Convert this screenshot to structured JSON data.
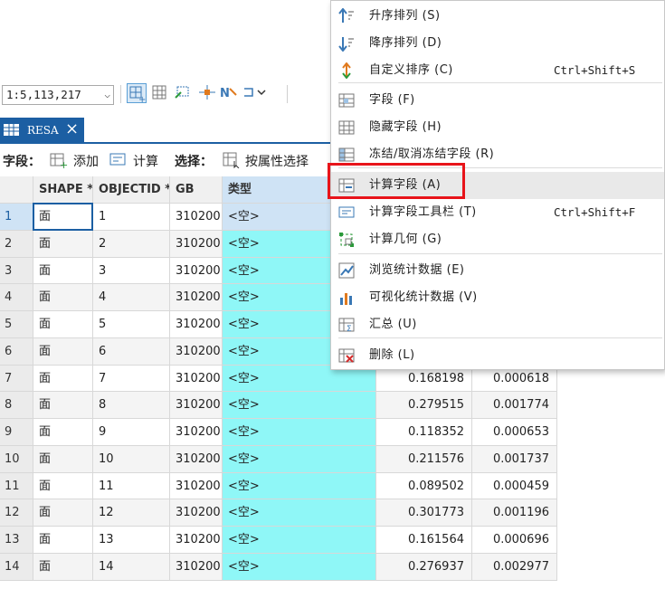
{
  "toolbar": {
    "scale": "1:5,113,217"
  },
  "tab": {
    "label": "RESA"
  },
  "fields_bar": {
    "fields_label": "字段：",
    "add": "添加",
    "calculate": "计算",
    "select_label": "选择：",
    "select_by_attr": "按属性选择"
  },
  "table": {
    "columns": [
      "",
      "SHAPE *",
      "OBJECTID *",
      "GB",
      "类型"
    ],
    "rows": [
      {
        "n": "1",
        "shape": "面",
        "oid": "1",
        "gb": "310200",
        "type": "<空>",
        "v1": "",
        "v2": ""
      },
      {
        "n": "2",
        "shape": "面",
        "oid": "2",
        "gb": "310200",
        "type": "<空>",
        "v1": "",
        "v2": ""
      },
      {
        "n": "3",
        "shape": "面",
        "oid": "3",
        "gb": "310200",
        "type": "<空>",
        "v1": "",
        "v2": ""
      },
      {
        "n": "4",
        "shape": "面",
        "oid": "4",
        "gb": "310200",
        "type": "<空>",
        "v1": "",
        "v2": ""
      },
      {
        "n": "5",
        "shape": "面",
        "oid": "5",
        "gb": "310200",
        "type": "<空>",
        "v1": "",
        "v2": ""
      },
      {
        "n": "6",
        "shape": "面",
        "oid": "6",
        "gb": "310200",
        "type": "<空>",
        "v1": "",
        "v2": ""
      },
      {
        "n": "7",
        "shape": "面",
        "oid": "7",
        "gb": "310200",
        "type": "<空>",
        "v1": "0.168198",
        "v2": "0.000618"
      },
      {
        "n": "8",
        "shape": "面",
        "oid": "8",
        "gb": "310200",
        "type": "<空>",
        "v1": "0.279515",
        "v2": "0.001774"
      },
      {
        "n": "9",
        "shape": "面",
        "oid": "9",
        "gb": "310200",
        "type": "<空>",
        "v1": "0.118352",
        "v2": "0.000653"
      },
      {
        "n": "10",
        "shape": "面",
        "oid": "10",
        "gb": "310200",
        "type": "<空>",
        "v1": "0.211576",
        "v2": "0.001737"
      },
      {
        "n": "11",
        "shape": "面",
        "oid": "11",
        "gb": "310200",
        "type": "<空>",
        "v1": "0.089502",
        "v2": "0.000459"
      },
      {
        "n": "12",
        "shape": "面",
        "oid": "12",
        "gb": "310200",
        "type": "<空>",
        "v1": "0.301773",
        "v2": "0.001196"
      },
      {
        "n": "13",
        "shape": "面",
        "oid": "13",
        "gb": "310200",
        "type": "<空>",
        "v1": "0.161564",
        "v2": "0.000696"
      },
      {
        "n": "14",
        "shape": "面",
        "oid": "14",
        "gb": "310200",
        "type": "<空>",
        "v1": "0.276937",
        "v2": "0.002977"
      }
    ]
  },
  "menu": {
    "items": [
      {
        "label": "升序排列 (S)",
        "shortcut": "",
        "icon": "sort-ascending-icon"
      },
      {
        "label": "降序排列 (D)",
        "shortcut": "",
        "icon": "sort-descending-icon"
      },
      {
        "label": "自定义排序 (C)",
        "shortcut": "Ctrl+Shift+S",
        "icon": "custom-sort-icon"
      },
      {
        "label": "字段 (F)",
        "shortcut": "",
        "icon": "fields-icon"
      },
      {
        "label": "隐藏字段 (H)",
        "shortcut": "",
        "icon": "hide-field-icon"
      },
      {
        "label": "冻结/取消冻结字段 (R)",
        "shortcut": "",
        "icon": "freeze-field-icon"
      },
      {
        "label": "计算字段 (A)",
        "shortcut": "",
        "icon": "calculate-field-icon"
      },
      {
        "label": "计算字段工具栏 (T)",
        "shortcut": "Ctrl+Shift+F",
        "icon": "calculate-toolbar-icon"
      },
      {
        "label": "计算几何 (G)",
        "shortcut": "",
        "icon": "calculate-geometry-icon"
      },
      {
        "label": "浏览统计数据 (E)",
        "shortcut": "",
        "icon": "statistics-icon"
      },
      {
        "label": "可视化统计数据 (V)",
        "shortcut": "",
        "icon": "visualize-statistics-icon"
      },
      {
        "label": "汇总 (U)",
        "shortcut": "",
        "icon": "summarize-icon"
      },
      {
        "label": "删除 (L)",
        "shortcut": "",
        "icon": "delete-field-icon"
      }
    ]
  },
  "colors": {
    "tab": "#1c5fa3",
    "type_column": "#8ff7f7",
    "highlight": "#e8141a",
    "selected_cell": "#cfe3f5"
  }
}
